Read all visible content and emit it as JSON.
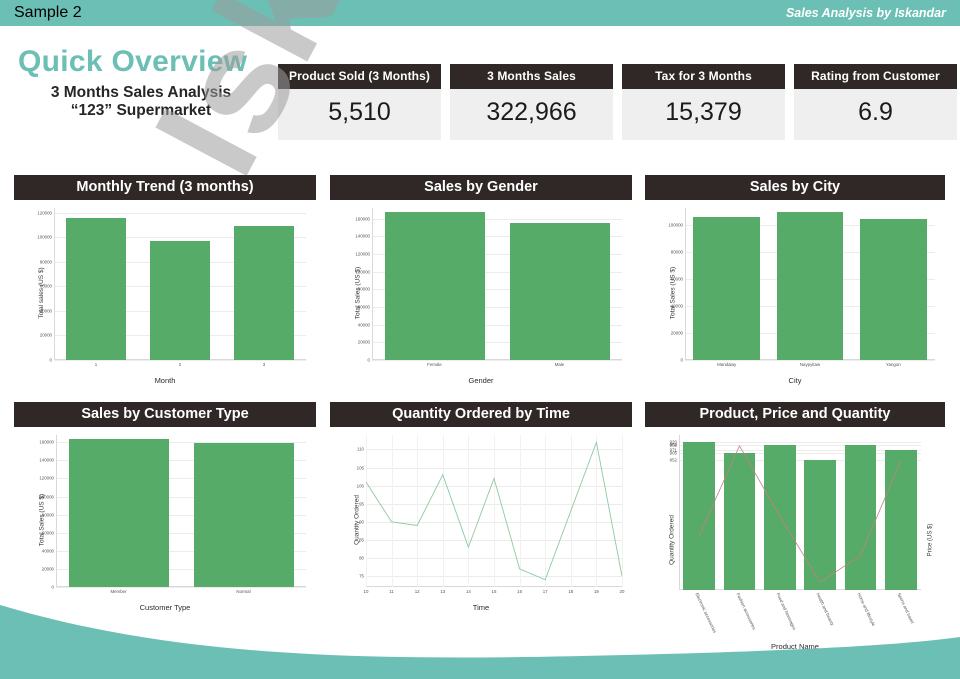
{
  "topbar": {
    "left_label": "Sample 2",
    "right_label": "Sales Analysis by Iskandar"
  },
  "header": {
    "title": "Quick Overview",
    "subtitle_line1": "3 Months Sales Analysis",
    "subtitle_line2": "“123” Supermarket"
  },
  "kpis": [
    {
      "label": "Product Sold (3 Months)",
      "value": "5,510"
    },
    {
      "label": "3 Months Sales",
      "value": "322,966"
    },
    {
      "label": "Tax for 3 Months",
      "value": "15,379"
    },
    {
      "label": "Rating from Customer",
      "value": "6.9"
    }
  ],
  "watermark": {
    "text": "Iskandar"
  },
  "colors": {
    "teal": "#6cbfb4",
    "dark": "#2f2826",
    "bar_green": "#56ab68",
    "line_green": "#8fc9a0",
    "line_red": "#c57f7f",
    "kpi_bg": "#efefef",
    "watermark": "#9d9d9d"
  },
  "chart_data": [
    {
      "id": "monthly-trend",
      "type": "bar",
      "title": "Monthly Trend (3 months)",
      "xlabel": "Month",
      "ylabel": "Total sales (US $)",
      "categories": [
        "1",
        "2",
        "3"
      ],
      "values": [
        116000,
        97000,
        109000
      ],
      "ylim": [
        0,
        124000
      ],
      "yticks": [
        0,
        20000,
        40000,
        60000,
        80000,
        100000,
        120000
      ],
      "ytick_labels": [
        "0",
        "20000",
        "40000",
        "60000",
        "80000",
        "100000",
        "120000"
      ],
      "grid": true,
      "legend": "none"
    },
    {
      "id": "sales-by-gender",
      "type": "bar",
      "title": "Sales by Gender",
      "xlabel": "Gender",
      "ylabel": "Total Sales (US $)",
      "categories": [
        "Female",
        "Male"
      ],
      "values": [
        168000,
        155000
      ],
      "ylim": [
        0,
        172000
      ],
      "yticks": [
        0,
        20000,
        40000,
        60000,
        80000,
        100000,
        120000,
        140000,
        160000
      ],
      "ytick_labels": [
        "0",
        "20000",
        "40000",
        "60000",
        "80000",
        "100000",
        "120000",
        "140000",
        "160000"
      ],
      "grid": true,
      "legend": "none"
    },
    {
      "id": "sales-by-city",
      "type": "bar",
      "title": "Sales by City",
      "xlabel": "City",
      "ylabel": "Total Sales (US $)",
      "categories": [
        "Mandalay",
        "Naypyitaw",
        "Yangon"
      ],
      "values": [
        106000,
        110200,
        105200
      ],
      "ylim": [
        0,
        113000
      ],
      "yticks": [
        0,
        20000,
        40000,
        60000,
        80000,
        100000
      ],
      "ytick_labels": [
        "0",
        "20000",
        "40000",
        "60000",
        "80000",
        "100000"
      ],
      "grid": true,
      "legend": "none"
    },
    {
      "id": "sales-by-customer-type",
      "type": "bar",
      "title": "Sales by Customer Type",
      "xlabel": "Customer Type",
      "ylabel": "Total Sales (US $)",
      "categories": [
        "Member",
        "Normal"
      ],
      "values": [
        164000,
        159000
      ],
      "ylim": [
        0,
        168000
      ],
      "yticks": [
        0,
        20000,
        40000,
        60000,
        80000,
        100000,
        120000,
        140000,
        160000
      ],
      "ytick_labels": [
        "0",
        "20000",
        "40000",
        "60000",
        "80000",
        "100000",
        "120000",
        "140000",
        "160000"
      ],
      "grid": true,
      "legend": "none"
    },
    {
      "id": "quantity-ordered-by-time",
      "type": "line",
      "title": "Quantity Ordered by Time",
      "xlabel": "Time",
      "ylabel": "Quantity Ordered",
      "x": [
        10,
        11,
        12,
        13,
        14,
        15,
        16,
        17,
        18,
        19,
        20
      ],
      "values": [
        101,
        90,
        89,
        103,
        83,
        102,
        77,
        74,
        93,
        112,
        75
      ],
      "xticks": [
        10,
        11,
        12,
        13,
        14,
        15,
        16,
        17,
        18,
        19,
        20
      ],
      "yticks": [
        75,
        80,
        85,
        90,
        95,
        100,
        105,
        110
      ],
      "ytick_labels": [
        "75",
        "80",
        "85",
        "90",
        "95",
        "100",
        "105",
        "110"
      ],
      "ylim": [
        72,
        114
      ],
      "xlim": [
        10,
        20
      ],
      "grid": true,
      "legend": "none"
    },
    {
      "id": "product-price-quantity",
      "type": "bar",
      "title": "Product, Price and Quantity",
      "xlabel": "Product Name",
      "ylabel": "Quantity Ordered",
      "y2label": "Price (US $)",
      "categories": [
        "Electronic accessories",
        "Fashion accessories",
        "Food and beverages",
        "Health and beauty",
        "Home and lifestyle",
        "Sports and travel"
      ],
      "values": [
        971,
        902,
        952,
        854,
        955,
        920
      ],
      "yticks": [
        971,
        902,
        952,
        854,
        955,
        920
      ],
      "ytick_labels": [
        "920",
        "905",
        "854",
        "952",
        "902",
        "971"
      ],
      "series": [
        {
          "name": "Quantity Ordered",
          "values": [
            971,
            902,
            952,
            854,
            955,
            920
          ]
        },
        {
          "name": "Price (US $)",
          "values": [
            55.67,
            57.25,
            56.01,
            54.85,
            55.32,
            56.99
          ]
        }
      ],
      "grid": true,
      "legend": "none"
    }
  ]
}
